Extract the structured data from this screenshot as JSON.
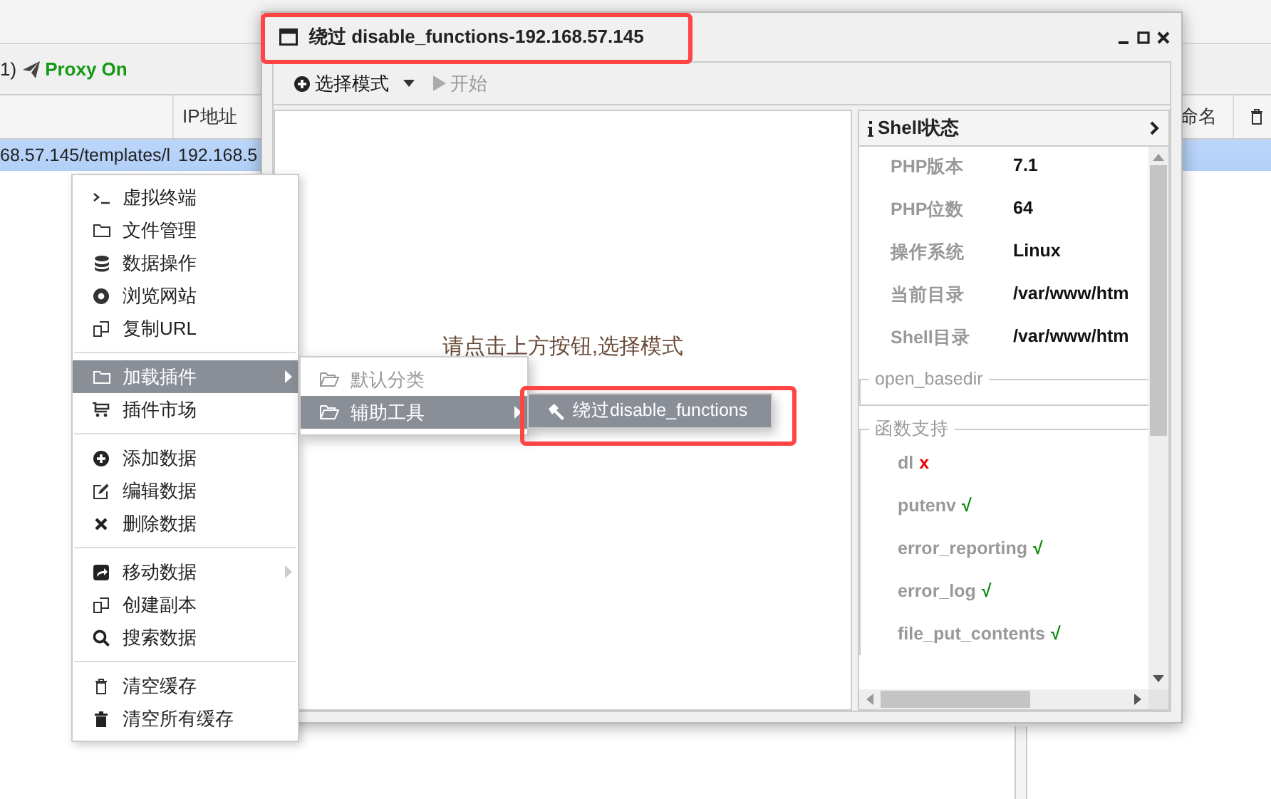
{
  "app": {
    "proxy_prefix": "1)",
    "proxy_status": "Proxy On",
    "columns": [
      {
        "label": "IP地址"
      },
      {
        "label": "命名"
      }
    ],
    "row": {
      "url": "68.57.145/templates/l",
      "ip": "192.168.5",
      "selected": true
    }
  },
  "dialog": {
    "title": "绕过 disable_functions-192.168.57.145",
    "toolbar": [
      {
        "label": "选择模式",
        "kind": "dropdown",
        "disabled": false
      },
      {
        "label": "开始",
        "kind": "play",
        "disabled": true
      }
    ],
    "prompt": "请点击上方按钮,选择模式",
    "shell_panel": {
      "title": "Shell状态",
      "info": [
        {
          "label": "PHP版本",
          "value": "7.1"
        },
        {
          "label": "PHP位数",
          "value": "64"
        },
        {
          "label": "操作系统",
          "value": "Linux"
        },
        {
          "label": "当前目录",
          "value": "/var/www/htm"
        },
        {
          "label": "Shell目录",
          "value": "/var/www/htm"
        }
      ],
      "open_basedir": {
        "legend": "open_basedir"
      },
      "functions": {
        "legend": "函数支持",
        "items": [
          {
            "name": "dl",
            "supported": false,
            "mark": "x"
          },
          {
            "name": "putenv",
            "supported": true,
            "mark": "√"
          },
          {
            "name": "error_reporting",
            "supported": true,
            "mark": "√"
          },
          {
            "name": "error_log",
            "supported": true,
            "mark": "√"
          },
          {
            "name": "file_put_contents",
            "supported": true,
            "mark": "√"
          }
        ]
      }
    }
  },
  "context_menu": {
    "groups": [
      [
        {
          "label": "虚拟终端",
          "kind": "plain",
          "selected": false
        },
        {
          "label": "文件管理",
          "kind": "plain",
          "selected": false
        },
        {
          "label": "数据操作",
          "kind": "plain",
          "selected": false
        },
        {
          "label": "浏览网站",
          "kind": "plain",
          "selected": false
        },
        {
          "label": "复制URL",
          "kind": "plain",
          "selected": false
        }
      ],
      [
        {
          "label": "加载插件",
          "kind": "submenu",
          "selected": true
        },
        {
          "label": "插件市场",
          "kind": "plain",
          "selected": false
        }
      ],
      [
        {
          "label": "添加数据",
          "kind": "plain",
          "selected": false
        },
        {
          "label": "编辑数据",
          "kind": "plain",
          "selected": false
        },
        {
          "label": "删除数据",
          "kind": "plain",
          "selected": false
        }
      ],
      [
        {
          "label": "移动数据",
          "kind": "submenu_disabled",
          "selected": false
        },
        {
          "label": "创建副本",
          "kind": "plain",
          "selected": false
        },
        {
          "label": "搜索数据",
          "kind": "plain",
          "selected": false
        }
      ],
      [
        {
          "label": "清空缓存",
          "kind": "plain",
          "selected": false
        },
        {
          "label": "清空所有缓存",
          "kind": "plain",
          "selected": false
        }
      ]
    ]
  },
  "plugin_submenu": [
    {
      "label": "默认分类",
      "kind": "plain",
      "disabled": true,
      "selected": false
    },
    {
      "label": "辅助工具",
      "kind": "submenu",
      "disabled": false,
      "selected": true
    }
  ],
  "tool_submenu": [
    {
      "label": "绕过disable_functions",
      "selected": true
    }
  ]
}
